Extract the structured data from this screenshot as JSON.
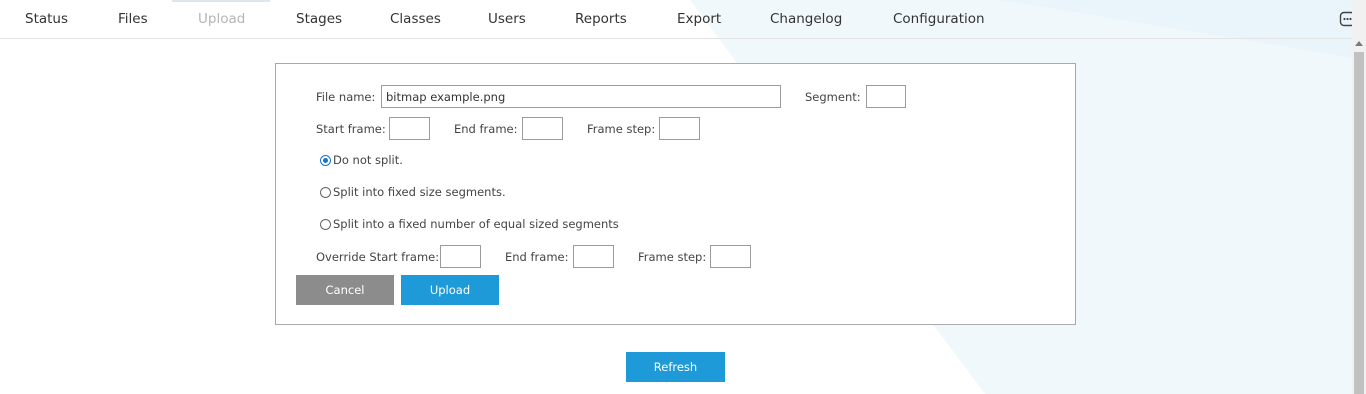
{
  "nav": {
    "items": [
      {
        "label": "Status",
        "active": false
      },
      {
        "label": "Files",
        "active": false
      },
      {
        "label": "Upload",
        "active": true
      },
      {
        "label": "Stages",
        "active": false
      },
      {
        "label": "Classes",
        "active": false
      },
      {
        "label": "Users",
        "active": false
      },
      {
        "label": "Reports",
        "active": false
      },
      {
        "label": "Export",
        "active": false
      },
      {
        "label": "Changelog",
        "active": false
      },
      {
        "label": "Configuration",
        "active": false
      }
    ],
    "menu_icon": "chat-ellipsis-icon"
  },
  "form": {
    "file_name_label": "File name:",
    "file_name_value": "bitmap example.png",
    "segment_label": "Segment:",
    "segment_value": "",
    "start_frame_label": "Start frame:",
    "start_frame_value": "",
    "end_frame_label": "End frame:",
    "end_frame_value": "",
    "frame_step_label": "Frame step:",
    "frame_step_value": "",
    "split_options": [
      {
        "label": "Do not split.",
        "checked": true
      },
      {
        "label": "Split into fixed size segments.",
        "checked": false
      },
      {
        "label": "Split into a fixed number of equal sized segments",
        "checked": false
      }
    ],
    "override_start_label": "Override Start frame:",
    "override_start_value": "",
    "override_end_label": "End frame:",
    "override_end_value": "",
    "override_step_label": "Frame step:",
    "override_step_value": "",
    "cancel_label": "Cancel",
    "upload_label": "Upload"
  },
  "refresh_label": "Refresh",
  "colors": {
    "accent": "#1f9ad8",
    "cancel": "#8c8c8c",
    "radio_checked": "#1a73c9",
    "background_tint": "#f1f8fc"
  }
}
